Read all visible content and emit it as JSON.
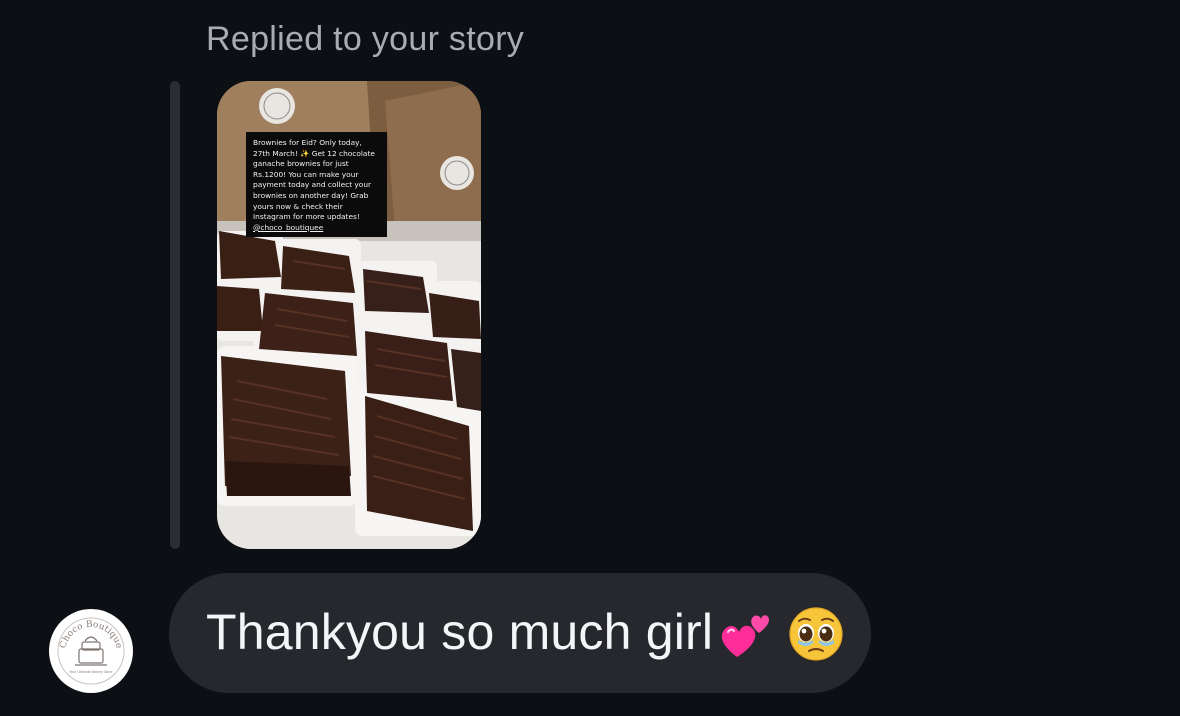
{
  "reply_header": {
    "label": "Replied to your story"
  },
  "story": {
    "caption_text": "Brownies for Eid? Only today, 27th March! ✨ Get 12 chocolate ganache brownies for just Rs.1200! You can make your payment today and collect your brownies on another day! Grab yours now & check their Instagram for more updates!",
    "caption_handle": "@choco_boutiquee",
    "box_logo_text": "Choco Boutique"
  },
  "message": {
    "text": "Thankyou so much girl",
    "emoji_1": "two-hearts",
    "emoji_2": "pleading-face"
  },
  "avatar": {
    "brand_name": "Choco Boutique",
    "tagline": "Your Ultimate Bakery Store"
  },
  "colors": {
    "background": "#0c0f14",
    "bubble": "#26282e",
    "text_primary": "#f4f5f7",
    "text_secondary": "#a8acb3"
  }
}
